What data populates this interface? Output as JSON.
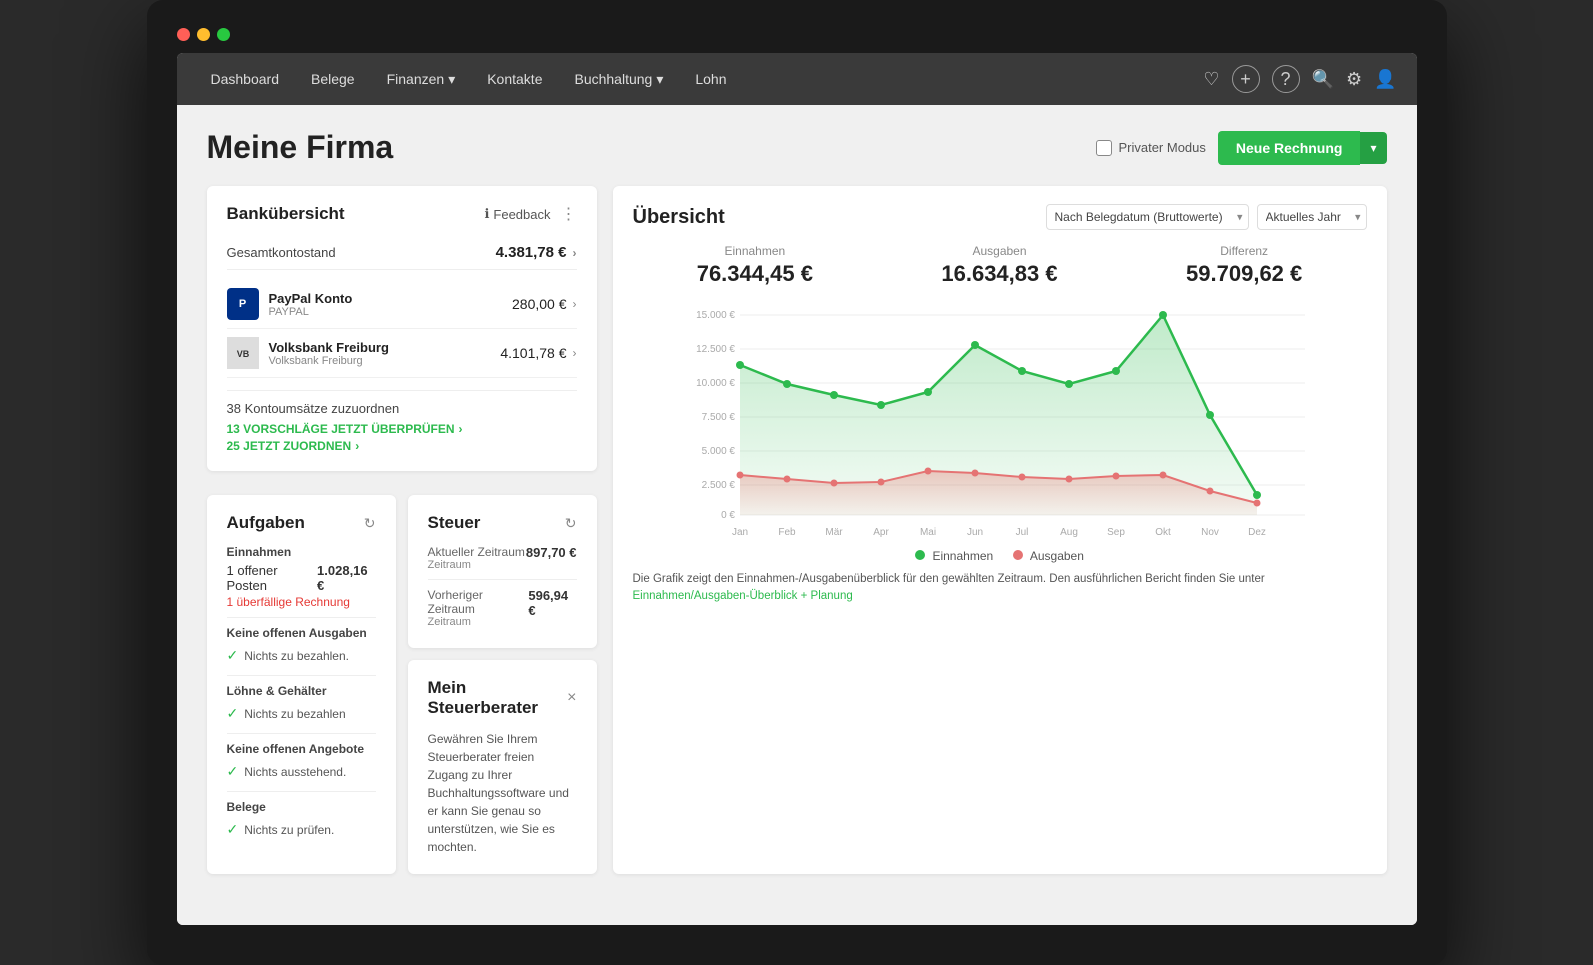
{
  "window": {
    "dots": [
      "red",
      "yellow",
      "green"
    ]
  },
  "nav": {
    "items": [
      {
        "label": "Dashboard",
        "has_dropdown": false
      },
      {
        "label": "Belege",
        "has_dropdown": false
      },
      {
        "label": "Finanzen",
        "has_dropdown": true
      },
      {
        "label": "Kontakte",
        "has_dropdown": false
      },
      {
        "label": "Buchhaltung",
        "has_dropdown": true
      },
      {
        "label": "Lohn",
        "has_dropdown": false
      }
    ]
  },
  "page": {
    "title": "Meine Firma",
    "private_mode_label": "Privater Modus",
    "neue_rechnung_label": "Neue Rechnung"
  },
  "bank": {
    "card_title": "Bankübersicht",
    "feedback_label": "Feedback",
    "gesamtkontostand_label": "Gesamtkontostand",
    "gesamtkontostand_value": "4.381,78 €",
    "accounts": [
      {
        "name": "PayPal Konto",
        "sub": "PAYPAL",
        "amount": "280,00 €",
        "logo_type": "paypal",
        "logo_text": "P"
      },
      {
        "name": "Volksbank Freiburg",
        "sub": "Volksbank Freiburg",
        "amount": "4.101,78 €",
        "logo_type": "volksbank",
        "logo_text": "VB"
      }
    ],
    "kontoumsaetze_label": "38 Kontoumsätze zuzuordnen",
    "link1": "13 VORSCHLÄGE JETZT ÜBERPRÜFEN",
    "link2": "25 JETZT ZUORDNEN"
  },
  "aufgaben": {
    "card_title": "Aufgaben",
    "sections": [
      {
        "label": "Einnahmen",
        "count_text": "1 offener Posten",
        "amount": "1.028,16 €",
        "overdue": "1 überfällige Rechnung"
      },
      {
        "label": "Keine offenen Ausgaben",
        "no_items": "Nichts zu bezahlen."
      },
      {
        "label": "Löhne & Gehälter",
        "no_items": "Nichts zu bezahlen"
      },
      {
        "label": "Keine offenen Angebote",
        "no_items": "Nichts ausstehend."
      },
      {
        "label": "Belege",
        "no_items": "Nichts zu prüfen."
      }
    ]
  },
  "steuer": {
    "card_title": "Steuer",
    "aktueller_zeitraum_label": "Aktueller Zeitraum",
    "aktueller_zeitraum_value": "897,70 €",
    "vorheriger_zeitraum_label": "Vorheriger Zeitraum",
    "vorheriger_zeitraum_value": "596,94 €"
  },
  "steuerberater": {
    "card_title": "Mein Steuerberater",
    "text": "Gewähren Sie Ihrem Steuerberater freien Zugang zu Ihrer Buchhaltungssoftware und er kann Sie genau so unterstützen, wie Sie es mochten."
  },
  "uebersicht": {
    "title": "Übersicht",
    "filter1": "Nach Belegdatum (Bruttowerte)",
    "filter2": "Aktuelles Jahr",
    "einnahmen_label": "Einnahmen",
    "einnahmen_value": "76.344,45 €",
    "ausgaben_label": "Ausgaben",
    "ausgaben_value": "16.634,83 €",
    "differenz_label": "Differenz",
    "differenz_value": "59.709,62 €",
    "chart_note": "Die Grafik zeigt den Einnahmen-/Ausgabenüberblick für den gewählten Zeitraum. Den ausführlichen Bericht finden Sie unter",
    "chart_note_link": "Einnahmen/Ausgaben-Überblick + Planung",
    "legend_einnahmen": "Einnahmen",
    "legend_ausgaben": "Ausgaben",
    "months": [
      "Jan",
      "Feb",
      "Mär",
      "Apr",
      "Mai",
      "Jun",
      "Jul",
      "Aug",
      "Sep",
      "Okt",
      "Nov",
      "Dez"
    ],
    "y_labels": [
      "15.000 €",
      "12.500 €",
      "10.000 €",
      "7.500 €",
      "5.000 €",
      "2.500 €",
      "0 €"
    ],
    "einnahmen_data": [
      75,
      68,
      60,
      55,
      63,
      85,
      72,
      68,
      72,
      100,
      48,
      10
    ],
    "ausgaben_data": [
      18,
      16,
      14,
      15,
      22,
      20,
      17,
      16,
      18,
      19,
      10,
      5
    ]
  }
}
